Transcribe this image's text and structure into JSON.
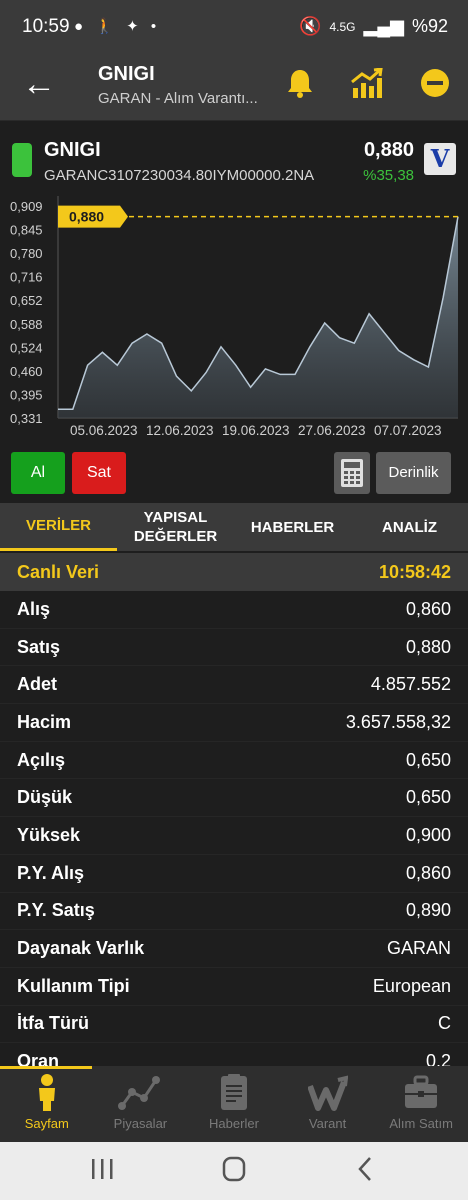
{
  "status_bar": {
    "time": "10:59",
    "network": "4.5G",
    "battery": "%92"
  },
  "header": {
    "title": "GNIGI",
    "subtitle": "GARAN - Alım Varantı..."
  },
  "instrument": {
    "name": "GNIGI",
    "code": "GARANC3107230034.80IYM00000.2NA",
    "price": "0,880",
    "change": "%35,38",
    "badge": "V"
  },
  "chart_data": {
    "type": "area",
    "current_label": "0,880",
    "y_ticks": [
      "0,909",
      "0,845",
      "0,780",
      "0,716",
      "0,652",
      "0,588",
      "0,524",
      "0,460",
      "0,395",
      "0,331"
    ],
    "x_ticks": [
      "05.06.2023",
      "12.06.2023",
      "19.06.2023",
      "27.06.2023",
      "07.07.2023"
    ],
    "ylim": [
      0.331,
      0.909
    ],
    "values": [
      0.355,
      0.355,
      0.475,
      0.51,
      0.475,
      0.535,
      0.56,
      0.535,
      0.445,
      0.405,
      0.455,
      0.525,
      0.475,
      0.415,
      0.465,
      0.45,
      0.45,
      0.525,
      0.59,
      0.55,
      0.535,
      0.615,
      0.565,
      0.515,
      0.49,
      0.47,
      0.66,
      0.88
    ],
    "colors": {
      "line": "#b8c8d6",
      "fill_top": "#6e7f8c",
      "fill_bottom": "#1e1e1e",
      "marker": "#f3c81b"
    }
  },
  "actions": {
    "buy": "Al",
    "sell": "Sat",
    "depth": "Derinlik"
  },
  "tabs": [
    {
      "label": "VERİLER",
      "active": true
    },
    {
      "label": "YAPISAL DEĞERLER",
      "active": false
    },
    {
      "label": "HABERLER",
      "active": false
    },
    {
      "label": "ANALİZ",
      "active": false
    }
  ],
  "live": {
    "label": "Canlı Veri",
    "time": "10:58:42"
  },
  "rows": [
    {
      "key": "Alış",
      "value": "0,860"
    },
    {
      "key": "Satış",
      "value": "0,880"
    },
    {
      "key": "Adet",
      "value": "4.857.552"
    },
    {
      "key": "Hacim",
      "value": "3.657.558,32"
    },
    {
      "key": "Açılış",
      "value": "0,650"
    },
    {
      "key": "Düşük",
      "value": "0,650"
    },
    {
      "key": "Yüksek",
      "value": "0,900"
    },
    {
      "key": "P.Y. Alış",
      "value": "0,860"
    },
    {
      "key": "P.Y. Satış",
      "value": "0,890"
    },
    {
      "key": "Dayanak Varlık",
      "value": "GARAN"
    },
    {
      "key": "Kullanım Tipi",
      "value": "European"
    },
    {
      "key": "İtfa Türü",
      "value": "C"
    },
    {
      "key": "Oran",
      "value": "0,2"
    }
  ],
  "bottom_nav": [
    {
      "label": "Sayfam",
      "icon": "person-icon",
      "active": true
    },
    {
      "label": "Piyasalar",
      "icon": "market-graph-icon",
      "active": false
    },
    {
      "label": "Haberler",
      "icon": "news-icon",
      "active": false
    },
    {
      "label": "Varant",
      "icon": "warrant-icon",
      "active": false
    },
    {
      "label": "Alım Satım",
      "icon": "briefcase-icon",
      "active": false
    }
  ],
  "theme": {
    "accent": "#f3c81b",
    "buy": "#15a01d",
    "sell": "#d91c1c",
    "positive": "#3cc23c"
  }
}
